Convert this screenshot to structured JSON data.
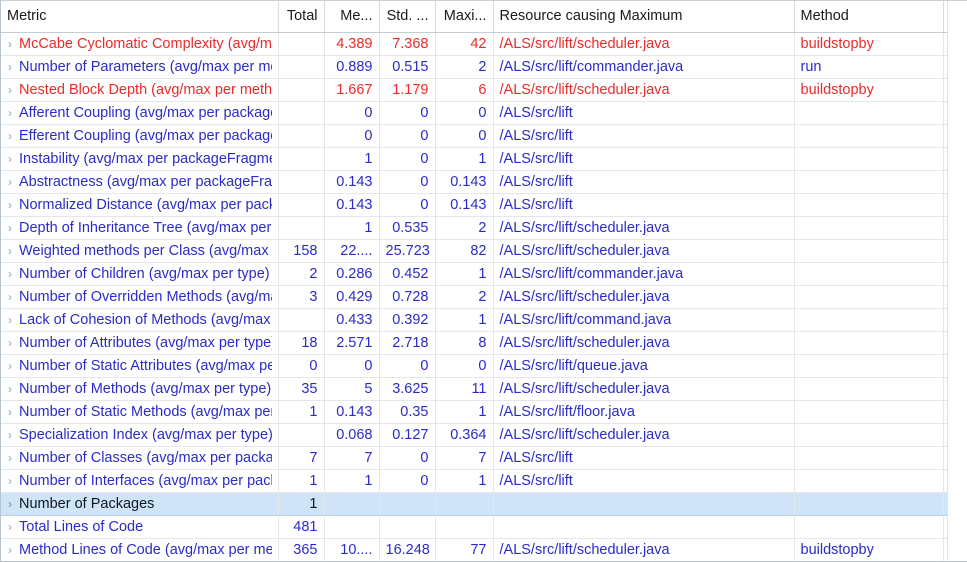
{
  "table": {
    "columns": [
      {
        "key": "metric",
        "label": "Metric",
        "align": "left"
      },
      {
        "key": "total",
        "label": "Total",
        "align": "right"
      },
      {
        "key": "mean",
        "label": "Me...",
        "align": "right"
      },
      {
        "key": "std",
        "label": "Std. ...",
        "align": "right"
      },
      {
        "key": "max",
        "label": "Maxi...",
        "align": "right"
      },
      {
        "key": "resource",
        "label": "Resource causing Maximum",
        "align": "left"
      },
      {
        "key": "method",
        "label": "Method",
        "align": "left"
      }
    ],
    "twisty_glyph": "›",
    "colors": {
      "red": "#ea2b2b",
      "blue": "#2b2bc8",
      "selection": "#cfe5f7",
      "header_text": "#1a1a1a",
      "grid": "#e3e7ea"
    },
    "rows": [
      {
        "metric": "McCabe Cyclomatic Complexity (avg/max per method)",
        "total": "",
        "mean": "4.389",
        "std": "7.368",
        "max": "42",
        "resource": "/ALS/src/lift/scheduler.java",
        "method": "buildstopby",
        "color": "red",
        "selected": false
      },
      {
        "metric": "Number of Parameters (avg/max per method)",
        "total": "",
        "mean": "0.889",
        "std": "0.515",
        "max": "2",
        "resource": "/ALS/src/lift/commander.java",
        "method": "run",
        "color": "blue",
        "selected": false
      },
      {
        "metric": "Nested Block Depth (avg/max per method)",
        "total": "",
        "mean": "1.667",
        "std": "1.179",
        "max": "6",
        "resource": "/ALS/src/lift/scheduler.java",
        "method": "buildstopby",
        "color": "red",
        "selected": false
      },
      {
        "metric": "Afferent Coupling (avg/max per packageFragment)",
        "total": "",
        "mean": "0",
        "std": "0",
        "max": "0",
        "resource": "/ALS/src/lift",
        "method": "",
        "color": "blue",
        "selected": false
      },
      {
        "metric": "Efferent Coupling (avg/max per packageFragment)",
        "total": "",
        "mean": "0",
        "std": "0",
        "max": "0",
        "resource": "/ALS/src/lift",
        "method": "",
        "color": "blue",
        "selected": false
      },
      {
        "metric": "Instability (avg/max per packageFragment)",
        "total": "",
        "mean": "1",
        "std": "0",
        "max": "1",
        "resource": "/ALS/src/lift",
        "method": "",
        "color": "blue",
        "selected": false
      },
      {
        "metric": "Abstractness (avg/max per packageFragment)",
        "total": "",
        "mean": "0.143",
        "std": "0",
        "max": "0.143",
        "resource": "/ALS/src/lift",
        "method": "",
        "color": "blue",
        "selected": false
      },
      {
        "metric": "Normalized Distance (avg/max per packageFragment)",
        "total": "",
        "mean": "0.143",
        "std": "0",
        "max": "0.143",
        "resource": "/ALS/src/lift",
        "method": "",
        "color": "blue",
        "selected": false
      },
      {
        "metric": "Depth of Inheritance Tree (avg/max per type)",
        "total": "",
        "mean": "1",
        "std": "0.535",
        "max": "2",
        "resource": "/ALS/src/lift/scheduler.java",
        "method": "",
        "color": "blue",
        "selected": false
      },
      {
        "metric": "Weighted methods per Class (avg/max per type)",
        "total": "158",
        "mean": "22....",
        "std": "25.723",
        "max": "82",
        "resource": "/ALS/src/lift/scheduler.java",
        "method": "",
        "color": "blue",
        "selected": false
      },
      {
        "metric": "Number of Children (avg/max per type)",
        "total": "2",
        "mean": "0.286",
        "std": "0.452",
        "max": "1",
        "resource": "/ALS/src/lift/commander.java",
        "method": "",
        "color": "blue",
        "selected": false
      },
      {
        "metric": "Number of Overridden Methods (avg/max per type)",
        "total": "3",
        "mean": "0.429",
        "std": "0.728",
        "max": "2",
        "resource": "/ALS/src/lift/scheduler.java",
        "method": "",
        "color": "blue",
        "selected": false
      },
      {
        "metric": "Lack of Cohesion of Methods (avg/max per type)",
        "total": "",
        "mean": "0.433",
        "std": "0.392",
        "max": "1",
        "resource": "/ALS/src/lift/command.java",
        "method": "",
        "color": "blue",
        "selected": false
      },
      {
        "metric": "Number of Attributes (avg/max per type)",
        "total": "18",
        "mean": "2.571",
        "std": "2.718",
        "max": "8",
        "resource": "/ALS/src/lift/scheduler.java",
        "method": "",
        "color": "blue",
        "selected": false
      },
      {
        "metric": "Number of Static Attributes (avg/max per type)",
        "total": "0",
        "mean": "0",
        "std": "0",
        "max": "0",
        "resource": "/ALS/src/lift/queue.java",
        "method": "",
        "color": "blue",
        "selected": false
      },
      {
        "metric": "Number of Methods (avg/max per type)",
        "total": "35",
        "mean": "5",
        "std": "3.625",
        "max": "11",
        "resource": "/ALS/src/lift/scheduler.java",
        "method": "",
        "color": "blue",
        "selected": false
      },
      {
        "metric": "Number of Static Methods (avg/max per type)",
        "total": "1",
        "mean": "0.143",
        "std": "0.35",
        "max": "1",
        "resource": "/ALS/src/lift/floor.java",
        "method": "",
        "color": "blue",
        "selected": false
      },
      {
        "metric": "Specialization Index (avg/max per type)",
        "total": "",
        "mean": "0.068",
        "std": "0.127",
        "max": "0.364",
        "resource": "/ALS/src/lift/scheduler.java",
        "method": "",
        "color": "blue",
        "selected": false
      },
      {
        "metric": "Number of Classes (avg/max per packageFragment)",
        "total": "7",
        "mean": "7",
        "std": "0",
        "max": "7",
        "resource": "/ALS/src/lift",
        "method": "",
        "color": "blue",
        "selected": false
      },
      {
        "metric": "Number of Interfaces (avg/max per packageFragment)",
        "total": "1",
        "mean": "1",
        "std": "0",
        "max": "1",
        "resource": "/ALS/src/lift",
        "method": "",
        "color": "blue",
        "selected": false
      },
      {
        "metric": "Number of Packages",
        "total": "1",
        "mean": "",
        "std": "",
        "max": "",
        "resource": "",
        "method": "",
        "color": "blue",
        "selected": true
      },
      {
        "metric": "Total Lines of Code",
        "total": "481",
        "mean": "",
        "std": "",
        "max": "",
        "resource": "",
        "method": "",
        "color": "blue",
        "selected": false
      },
      {
        "metric": "Method Lines of Code (avg/max per method)",
        "total": "365",
        "mean": "10....",
        "std": "16.248",
        "max": "77",
        "resource": "/ALS/src/lift/scheduler.java",
        "method": "buildstopby",
        "color": "blue",
        "selected": false
      }
    ]
  }
}
